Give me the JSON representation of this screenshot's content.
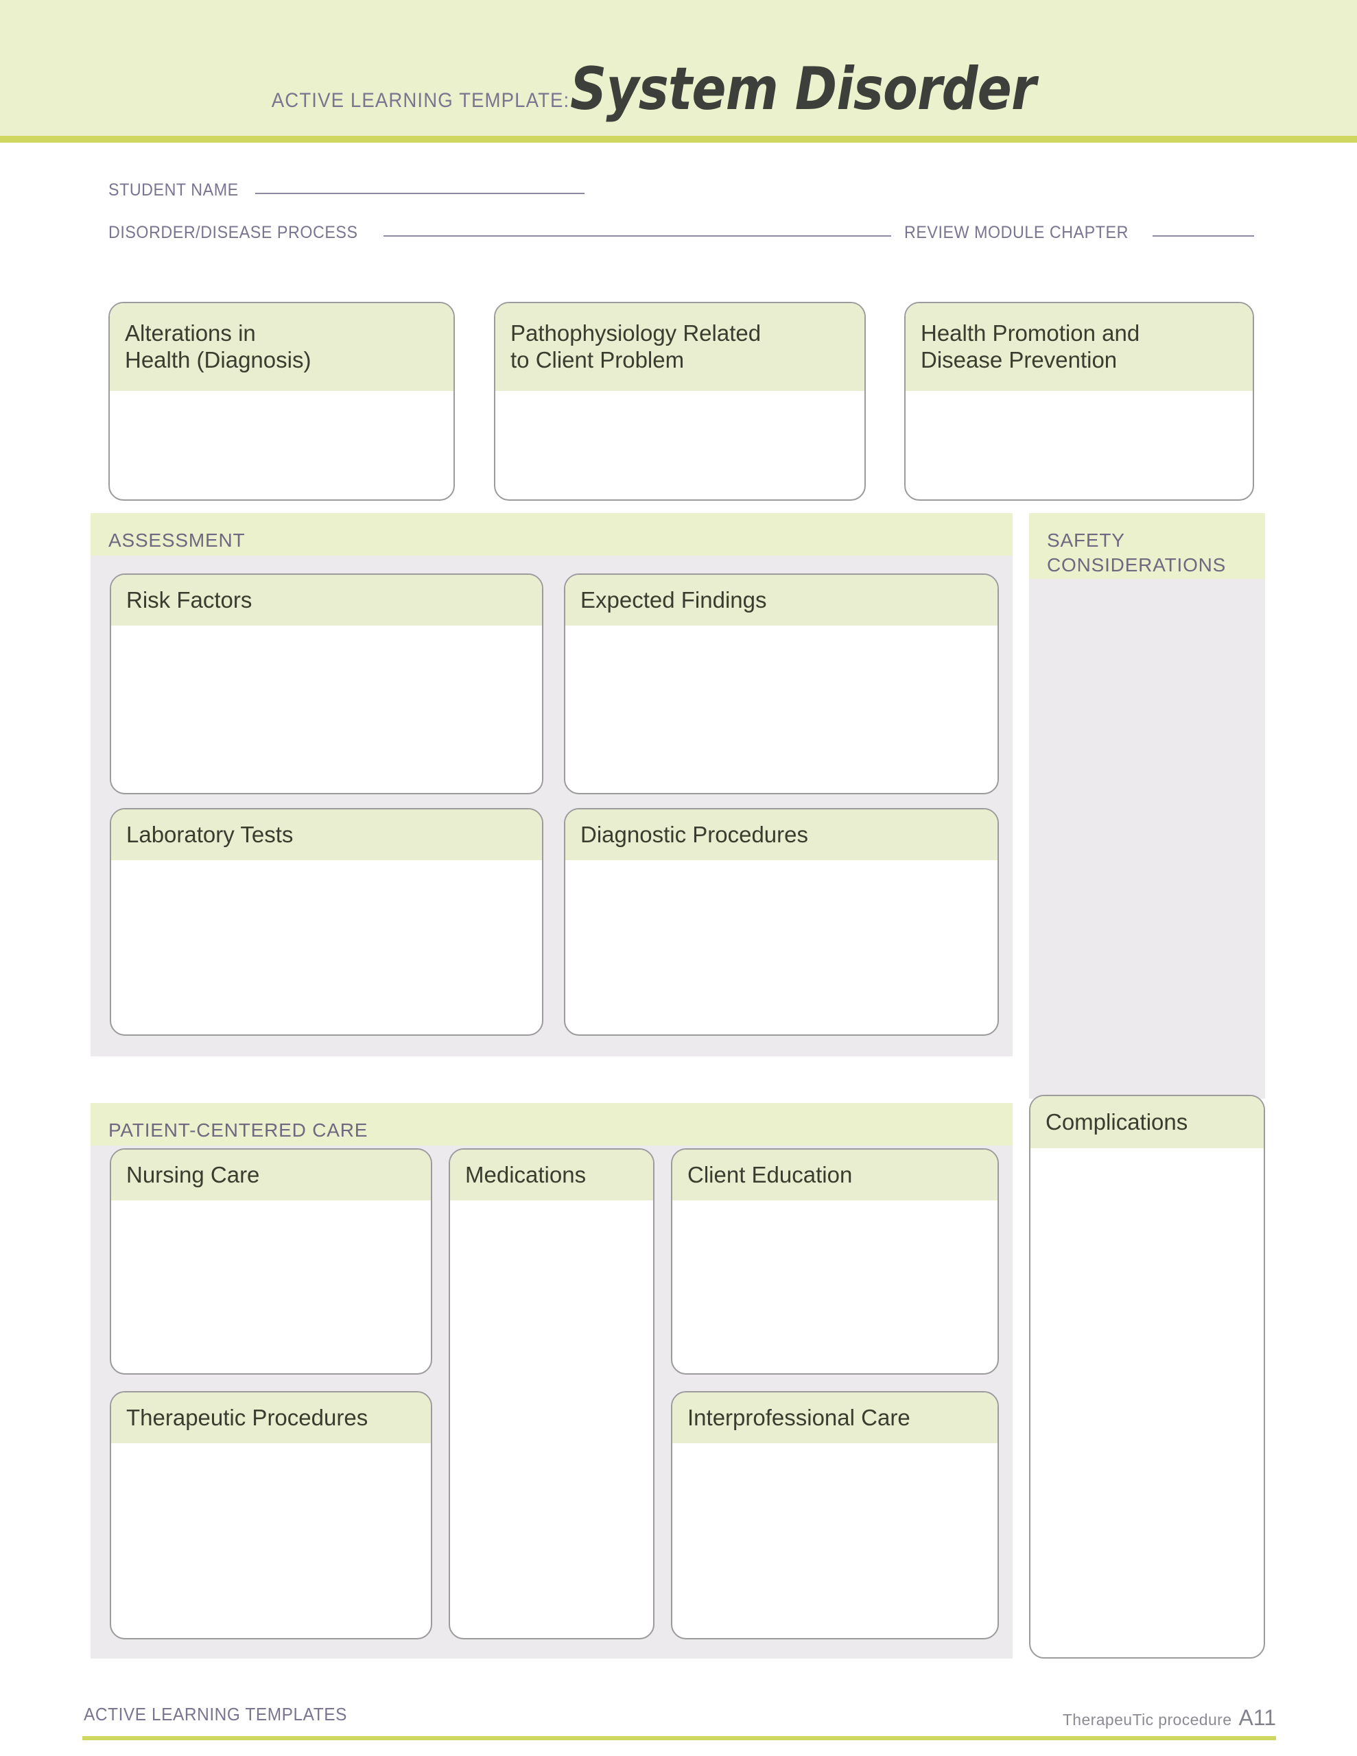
{
  "header": {
    "kicker": "ACTIVE LEARNING TEMPLATE:",
    "title": "System Disorder"
  },
  "form_fields": {
    "student_name_label": "STUDENT NAME",
    "student_name_value": "",
    "disorder_label": "DISORDER/DISEASE PROCESS",
    "disorder_value": "",
    "review_chapter_label": "REVIEW MODULE CHAPTER",
    "review_chapter_value": ""
  },
  "top_boxes": [
    {
      "title": "Alterations in\nHealth (Diagnosis)",
      "value": ""
    },
    {
      "title": "Pathophysiology  Related\nto Client Problem",
      "value": ""
    },
    {
      "title": "Health  Promotion  and\nDisease Prevention",
      "value": ""
    }
  ],
  "assessment": {
    "label": "ASSESSMENT",
    "boxes": [
      {
        "title": "Risk Factors",
        "value": ""
      },
      {
        "title": "Expected Findings",
        "value": ""
      },
      {
        "title": "Laboratory Tests",
        "value": ""
      },
      {
        "title": "Diagnostic Procedures",
        "value": ""
      }
    ]
  },
  "safety": {
    "label": "SAFETY\nCONSIDERATIONS",
    "value": ""
  },
  "complications": {
    "title": "Complications",
    "value": ""
  },
  "patient_centered_care": {
    "label": "PATIENT-CENTERED CARE",
    "boxes": [
      {
        "title": "Nursing Care",
        "value": ""
      },
      {
        "title": "Medications",
        "value": ""
      },
      {
        "title": "Client Education",
        "value": ""
      },
      {
        "title": "Therapeutic Procedures",
        "value": ""
      },
      {
        "title": "Interprofessional Care",
        "value": ""
      }
    ]
  },
  "footer": {
    "left": "ACTIVE LEARNING TEMPLATES",
    "procedure": "TherapeuTic procedure",
    "code": "A11"
  },
  "colors": {
    "header_band": "#ebf1cc",
    "accent_rule": "#cfd760",
    "card_header": "#eaeed0",
    "panel_gray": "#eceaed",
    "label_text": "#6f6880",
    "title_text": "#3a3c2e",
    "border": "#9b9b9b"
  }
}
